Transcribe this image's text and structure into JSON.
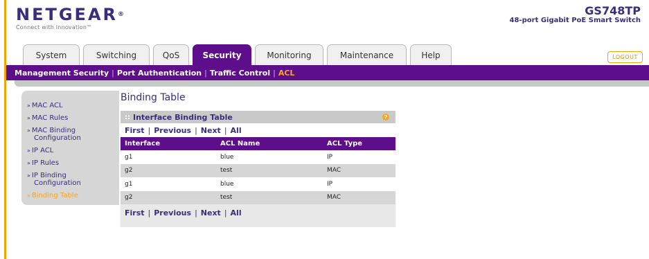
{
  "header": {
    "logo": "NETGEAR",
    "logo_reg": "®",
    "tagline": "Connect with Innovation™",
    "model": "GS748TP",
    "model_desc": "48-port Gigabit PoE Smart Switch",
    "logout": "LOGOUT"
  },
  "tabs": [
    {
      "label": "System"
    },
    {
      "label": "Switching"
    },
    {
      "label": "QoS"
    },
    {
      "label": "Security"
    },
    {
      "label": "Monitoring"
    },
    {
      "label": "Maintenance"
    },
    {
      "label": "Help"
    }
  ],
  "subnav": [
    {
      "label": "Management Security"
    },
    {
      "label": "Port Authentication"
    },
    {
      "label": "Traffic Control"
    },
    {
      "label": "ACL"
    }
  ],
  "leftmenu": [
    {
      "label": "MAC ACL"
    },
    {
      "label": "MAC Rules"
    },
    {
      "label": "MAC Binding",
      "cont": "Configuration"
    },
    {
      "label": "IP ACL"
    },
    {
      "label": "IP Rules"
    },
    {
      "label": "IP Binding",
      "cont": "Configuration"
    },
    {
      "label": "Binding Table"
    }
  ],
  "page": {
    "title": "Binding Table",
    "panel_title": "Interface Binding Table",
    "pager": {
      "first": "First",
      "previous": "Previous",
      "next": "Next",
      "all": "All"
    }
  },
  "table": {
    "headers": [
      "Interface",
      "ACL Name",
      "ACL Type"
    ],
    "rows": [
      [
        "g1",
        "blue",
        "IP"
      ],
      [
        "g2",
        "test",
        "MAC"
      ],
      [
        "g1",
        "blue",
        "IP"
      ],
      [
        "g2",
        "test",
        "MAC"
      ]
    ]
  },
  "colors": {
    "purple": "#5c0e8b",
    "accent": "#f5a623",
    "navy": "#3b2d7e"
  }
}
